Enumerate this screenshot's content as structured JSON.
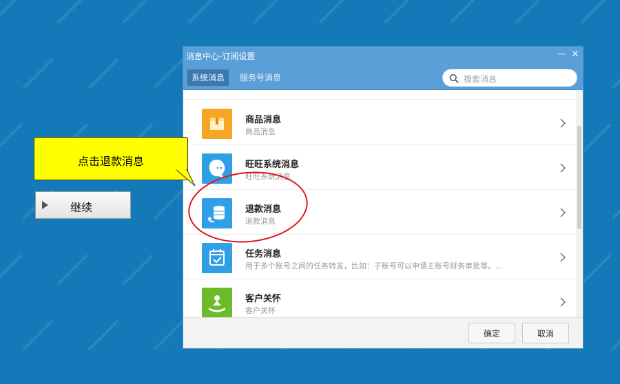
{
  "dialog": {
    "title": "消息中心-订阅设置",
    "minimize_glyph": "—",
    "close_glyph": "×",
    "tabs": [
      {
        "label": "系统消息",
        "active": true
      },
      {
        "label": "服务号消息",
        "active": false
      }
    ],
    "search": {
      "placeholder": "搜索消息"
    },
    "items": [
      {
        "name": "商品消息",
        "desc": "商品消息",
        "icon": "product-box-icon",
        "color": "#f5a623"
      },
      {
        "name": "旺旺系统消息",
        "desc": "旺旺系统消息",
        "icon": "wangwang-icon",
        "color": "#2fa0e8"
      },
      {
        "name": "退款消息",
        "desc": "退款消息",
        "icon": "refund-coins-icon",
        "color": "#2fa0e8"
      },
      {
        "name": "任务消息",
        "desc": "用于多个账号之间的任务转发，比如：子账号可以申请主账号财务审批等。...",
        "icon": "task-calendar-icon",
        "color": "#2fa0e8"
      },
      {
        "name": "客户关怀",
        "desc": "客户关怀",
        "icon": "customer-care-icon",
        "color": "#6cbb2b"
      }
    ],
    "buttons": {
      "ok": "确定",
      "cancel": "取消"
    }
  },
  "tutorial": {
    "callout_text": "点击退款消息",
    "continue_label": "继续",
    "highlight_color": "#e0141e",
    "callout_color": "#ffff00"
  },
  "colors": {
    "desktop": "#1379b8",
    "titlebar": "#5a9fd7"
  }
}
